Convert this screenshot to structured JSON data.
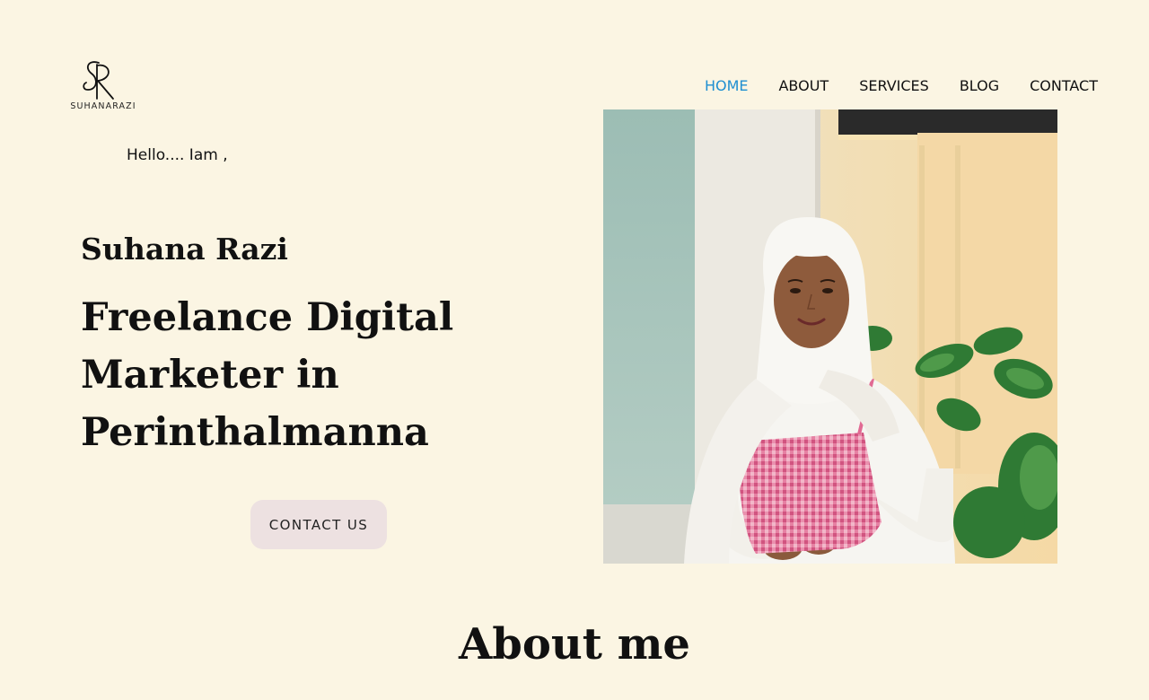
{
  "brand": {
    "logo_initials": "SR",
    "logo_text": "SUHANARAZI"
  },
  "nav": {
    "items": [
      {
        "label": "HOME",
        "active": true
      },
      {
        "label": "ABOUT",
        "active": false
      },
      {
        "label": "SERVICES",
        "active": false
      },
      {
        "label": "BLOG",
        "active": false
      },
      {
        "label": "CONTACT",
        "active": false
      }
    ],
    "active_color": "#1f8fd1"
  },
  "hero": {
    "greeting": "Hello.... Iam ,",
    "name": "Suhana Razi",
    "headline_lines": [
      "Freelance Digital",
      "Marketer in",
      "Perinthalmanna"
    ],
    "cta_label": "CONTACT US"
  },
  "about": {
    "title": "About me"
  },
  "colors": {
    "background": "#fbf5e3",
    "button_background": "#ede1e1"
  }
}
